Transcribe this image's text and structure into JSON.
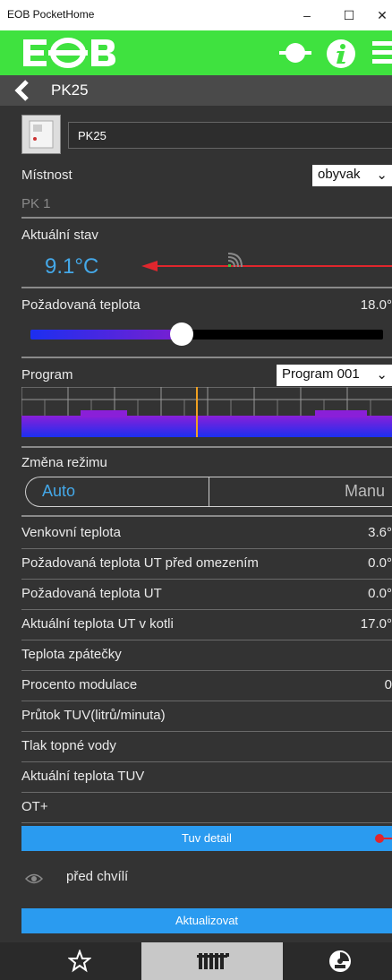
{
  "window": {
    "title": "EOB PocketHome",
    "minimize": "–",
    "maximize": "☐",
    "close": "✕"
  },
  "colors": {
    "app_green": "#3fe23f",
    "accent_blue": "#2a9bf0",
    "temp_blue": "#44a8e8",
    "arrow_red": "#e0262d"
  },
  "header": {
    "logo": "EOB",
    "icons": [
      "target-icon",
      "info-icon",
      "menu-icon"
    ]
  },
  "subheader": {
    "title": "PK25"
  },
  "device": {
    "name": "PK25"
  },
  "room": {
    "label": "Místnost",
    "selected": "obyvak",
    "sublabel": "PK 1"
  },
  "status": {
    "label": "Aktuální stav",
    "temperature": "9.1°C"
  },
  "desired": {
    "label": "Požadovaná teplota",
    "value": "18.0°",
    "slider_fraction": 0.43
  },
  "program": {
    "label": "Program",
    "selected": "Program 001"
  },
  "mode": {
    "label": "Změna režimu",
    "auto": "Auto",
    "manu": "Manu"
  },
  "rows": [
    {
      "label": "Venkovní teplota",
      "value": "3.6°"
    },
    {
      "label": "Požadovaná teplota UT před omezením",
      "value": "0.0°"
    },
    {
      "label": "Požadovaná teplota UT",
      "value": "0.0°"
    },
    {
      "label": "Aktuální teplota UT v kotli",
      "value": "17.0°"
    },
    {
      "label": "Teplota zpátečky",
      "value": ""
    },
    {
      "label": "Procento modulace",
      "value": "0"
    },
    {
      "label": "Průtok TUV(litrů/minuta)",
      "value": ""
    },
    {
      "label": "Tlak topné vody",
      "value": ""
    },
    {
      "label": "Aktuální teplota TUV",
      "value": ""
    },
    {
      "label": "OT+",
      "value": ""
    }
  ],
  "actions": {
    "tuv_detail": "Tuv detail",
    "last_seen": "před chvílí",
    "refresh": "Aktualizovat"
  },
  "tabs": [
    "star-icon",
    "radiator-icon",
    "gauge-icon"
  ]
}
